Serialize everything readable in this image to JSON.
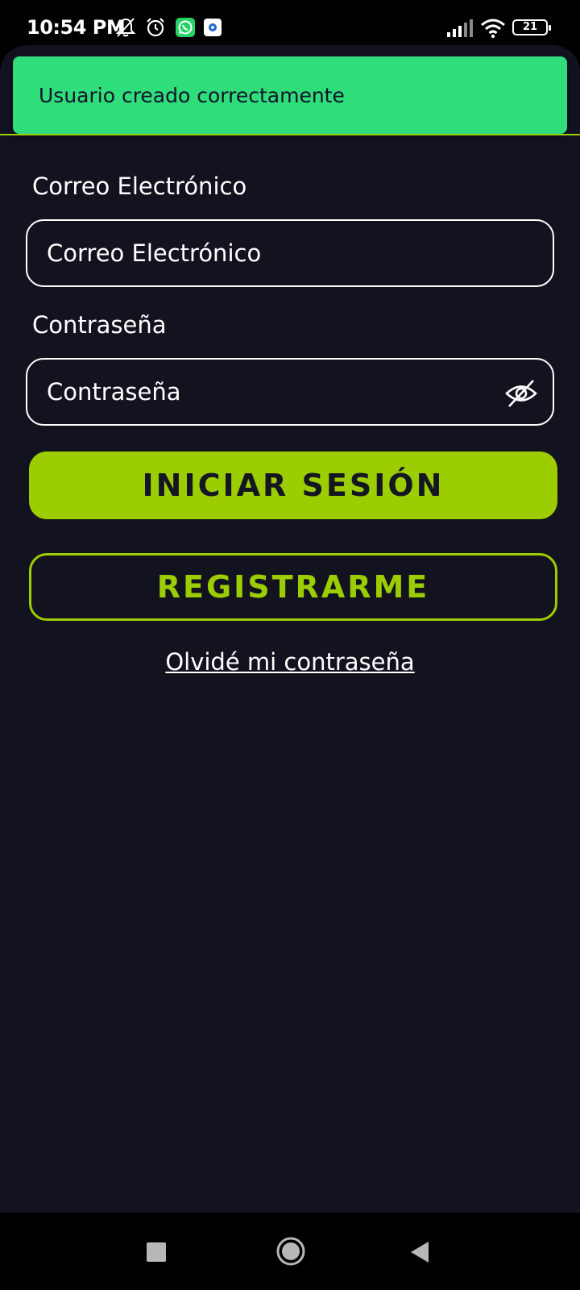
{
  "status_bar": {
    "time": "10:54 PM",
    "battery": "21",
    "icons": [
      "mute-notification-icon",
      "alarm-icon",
      "whatsapp-icon",
      "app-notification-icon",
      "signal-icon",
      "wifi-icon",
      "battery-icon"
    ]
  },
  "toast": {
    "message": "Usuario creado correctamente",
    "color": "#2fdd7b"
  },
  "form": {
    "email_label": "Correo Electrónico",
    "email_placeholder": "Correo Electrónico",
    "password_label": "Contraseña",
    "password_placeholder": "Contraseña"
  },
  "buttons": {
    "login": "INICIAR SESIÓN",
    "register": "REGISTRARME",
    "forgot_password": "Olvidé mi contraseña"
  },
  "colors": {
    "accent": "#9ccd00",
    "background": "#131320"
  },
  "nav_bar": {
    "icons": [
      "recent-apps-icon",
      "home-icon",
      "back-icon"
    ]
  }
}
